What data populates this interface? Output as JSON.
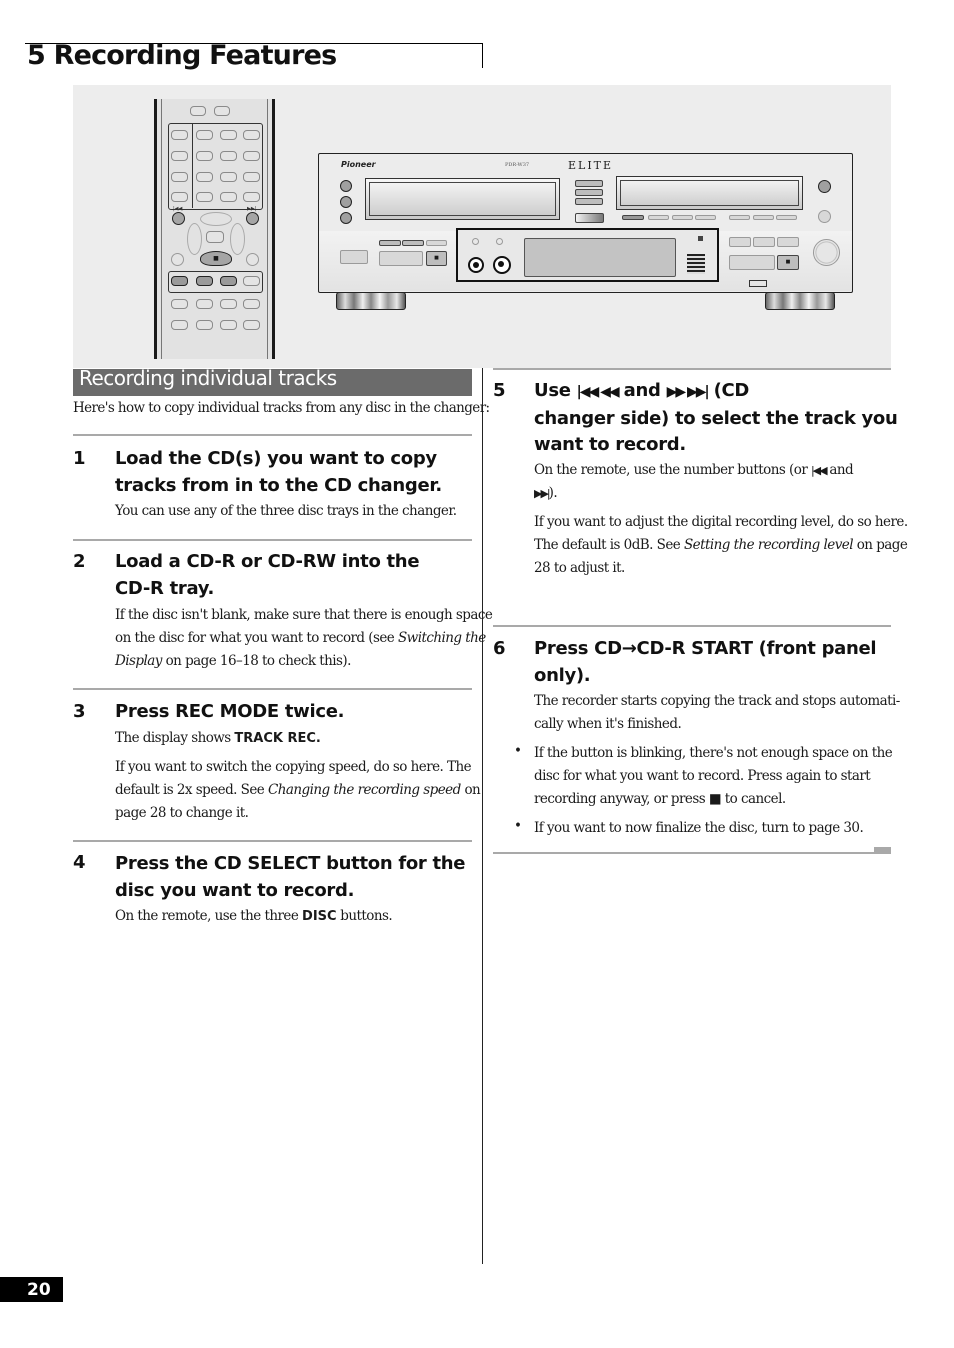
{
  "chapter": {
    "title": "5 Recording Features"
  },
  "illustration": {
    "remote_labels": {
      "prev": "|◀◀",
      "next": "▶▶|",
      "stop": "■"
    },
    "deck": {
      "brand": "Pioneer",
      "model": "PDR-W37",
      "series": "ELITE",
      "stop_symbol": "■"
    }
  },
  "section": {
    "title": "Recording individual tracks",
    "intro": "Here's how to copy individual tracks from any disc in the changer:"
  },
  "steps": [
    {
      "number": "1",
      "heading_lines": [
        "Load the CD(s) you want to copy",
        "tracks from in to the CD changer."
      ],
      "body": "You can use any of the three disc trays in the changer."
    },
    {
      "number": "2",
      "heading_lines": [
        "Load a CD-R or CD-RW into the",
        "CD-R tray."
      ],
      "body_lines": [
        "If the disc isn't blank, make sure that there is enough space",
        "on the disc for what you want to record (see ",
        "Switching the",
        "Display",
        " on page 16–18 to check this)."
      ]
    },
    {
      "number": "3",
      "heading": "Press REC MODE twice.",
      "display_prefix": "The display shows ",
      "display_value": "TRACK REC.",
      "body_lines": [
        "If you want to switch the copying speed, do so here. The",
        "default is 2x speed. See ",
        "Changing the recording speed",
        " on",
        "page 28 to change it."
      ]
    },
    {
      "number": "4",
      "heading_lines": [
        "Press the CD SELECT button for the",
        "disc you want to record."
      ],
      "body_prefix": "On the remote, use the three ",
      "body_key": "DISC",
      "body_suffix": " buttons."
    },
    {
      "number": "5",
      "heading_parts": {
        "use": "Use ",
        "rev_glyphs": "|◀◀ ◀◀",
        "and": " and ",
        "fwd_glyphs": "▶▶ ▶▶|",
        "rest_line1": " (CD",
        "line2": "changer side) to select the track you",
        "line3": "want to record."
      },
      "body1_prefix": "On the remote, use the number buttons (or ",
      "body1_glyph_a": "|◀◀",
      "body1_and": " and",
      "body1_glyph_b": "▶▶|",
      "body1_suffix": ").",
      "body2_lines": [
        "If you want to adjust the digital recording level, do so here.",
        "The default is 0dB. See ",
        "Setting the recording level",
        " on page",
        "28 to adjust it."
      ]
    },
    {
      "number": "6",
      "heading_line1_a": "Press CD",
      "heading_arrow": "→",
      "heading_line1_b": "CD-R START (front panel",
      "heading_line2": "only).",
      "body_lines": [
        "The recorder starts copying the track and stops automati-",
        "cally when it's finished."
      ],
      "bullets": [
        {
          "symbol": "•",
          "lines": [
            "If the button is blinking, there's not enough space on the",
            "disc for what you want to record. Press again to start",
            "recording anyway, or press ",
            "■",
            " to cancel."
          ]
        },
        {
          "symbol": "•",
          "lines": [
            "If you want to now finalize the disc, turn to page 30."
          ]
        }
      ]
    }
  ],
  "footer": {
    "page_number": "20"
  }
}
